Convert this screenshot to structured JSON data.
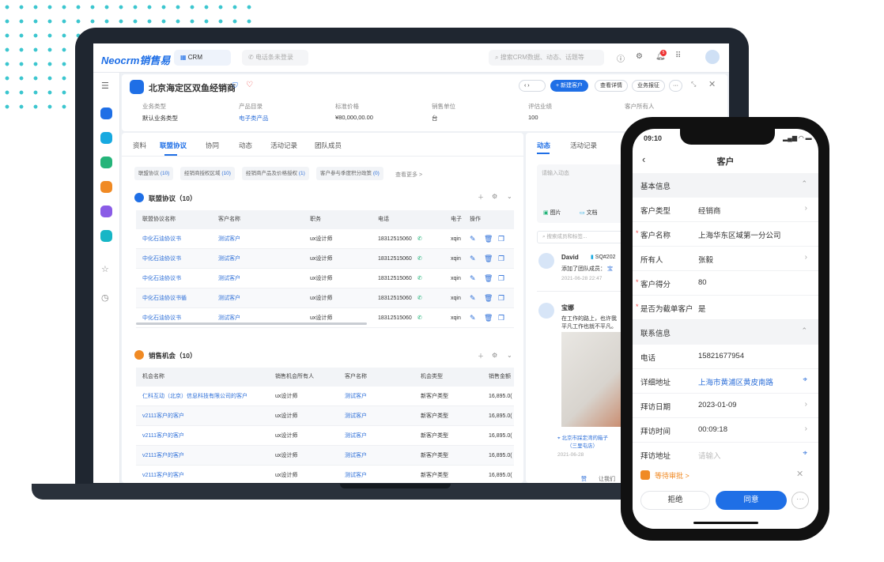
{
  "desktop": {
    "logo": "Neocrm销售易",
    "app_switch": "CRM",
    "phone_status": "电话条未登录",
    "search_placeholder": "搜索CRM数据、动态、话题等",
    "notification_count": "5",
    "record": {
      "title": "北京海定区双鱼经销商",
      "buttons": {
        "new": "+ 新建客户",
        "details": "查看详情",
        "report": "业务报征",
        "more": "···"
      },
      "fields": [
        {
          "label": "业务类型",
          "value": "默认业务类型"
        },
        {
          "label": "产品目录",
          "value": "电子类产品"
        },
        {
          "label": "标准价格",
          "value": "¥80,000,00.00"
        },
        {
          "label": "销售单位",
          "value": "台"
        },
        {
          "label": "评估业绩",
          "value": "100"
        },
        {
          "label": "客户所有人",
          "value": ""
        }
      ]
    },
    "tabs": [
      "资料",
      "联盟协议",
      "协同",
      "动态",
      "活动记录",
      "团队成员"
    ],
    "active_tab": "联盟协议",
    "chips": [
      {
        "label": "联盟协议",
        "count": "(10)"
      },
      {
        "label": "经销商授权区域",
        "count": "(10)"
      },
      {
        "label": "经销商产品及价格授权",
        "count": "(1)"
      },
      {
        "label": "客户参与季度积分政策",
        "count": "(0)"
      }
    ],
    "see_more": "查看更多 >",
    "agreements": {
      "title": "联盟协议（10）",
      "columns": [
        "联盟协议名称",
        "客户名称",
        "职务",
        "电话",
        "电子",
        "操作"
      ],
      "rows": [
        [
          "中化石油协议书",
          "测试客户",
          "ux设计师",
          "18312515060",
          "xqin"
        ],
        [
          "中化石油协议书",
          "测试客户",
          "ux设计师",
          "18312515060",
          "xqin"
        ],
        [
          "中化石油协议书",
          "测试客户",
          "ux设计师",
          "18312515060",
          "xqin"
        ],
        [
          "中化石油协议书循",
          "测试客户",
          "ux设计师",
          "18312515060",
          "xqin"
        ],
        [
          "中化石油协议书",
          "测试客户",
          "ux设计师",
          "18312515060",
          "xqin"
        ]
      ]
    },
    "opportunities": {
      "title": "销售机会（10）",
      "columns": [
        "机会名称",
        "销售机会所有人",
        "客户名称",
        "机会类型",
        "销售金额"
      ],
      "rows": [
        [
          "仁科互动（北京）信息科技有限公司的客户",
          "ux设计师",
          "测试客户",
          "新客户类型",
          "16,895.0("
        ],
        [
          "v2111客户的客户",
          "ux设计师",
          "测试客户",
          "新客户类型",
          "16,895.0("
        ],
        [
          "v2111客户的客户",
          "ux设计师",
          "测试客户",
          "新客户类型",
          "16,895.0("
        ],
        [
          "v2111客户的客户",
          "ux设计师",
          "测试客户",
          "新客户类型",
          "16,895.0("
        ],
        [
          "v2111客户的客户",
          "ux设计师",
          "测试客户",
          "新客户类型",
          "16,895.0("
        ]
      ]
    },
    "feed": {
      "tabs": [
        "动态",
        "活动记录"
      ],
      "input_placeholder": "请输入动态",
      "image_btn": "图片",
      "doc_btn": "文档",
      "search_placeholder": "搜索成员和标签...",
      "posts": [
        {
          "author": "David",
          "tag": "SQ#202",
          "text": "添加了团队成员：",
          "mention": "宝",
          "time": "2021-06-28 22:47"
        },
        {
          "author": "宝娜",
          "text": "在工作的路上，也许我",
          "text2": "平凡工作也就不平凡。",
          "location": "北京市踩定湾的箱子",
          "location2": "（三里屯店）",
          "time": "2021-06-28",
          "like": "赞",
          "comment": "让我们"
        }
      ]
    }
  },
  "mobile": {
    "time": "09:10",
    "title": "客户",
    "sections": [
      {
        "title": "基本信息",
        "rows": [
          {
            "label": "客户类型",
            "value": "经销商",
            "required": false,
            "chevron": true
          },
          {
            "label": "客户名称",
            "value": "上海华东区域第一分公司",
            "required": true
          },
          {
            "label": "所有人",
            "value": "张毅",
            "chevron": true
          },
          {
            "label": "客户得分",
            "value": "80",
            "required": true
          },
          {
            "label": "是否为截单客户",
            "value": "是",
            "required": true
          }
        ]
      },
      {
        "title": "联系信息",
        "rows": [
          {
            "label": "电话",
            "value": "15821677954"
          },
          {
            "label": "详细地址",
            "value": "上海市黄浦区黄皮南路",
            "link": true,
            "location": true
          },
          {
            "label": "拜访日期",
            "value": "2023-01-09",
            "chevron": true
          },
          {
            "label": "拜访时间",
            "value": "00:09:18",
            "chevron": true
          },
          {
            "label": "拜访地址",
            "value": "请输入",
            "placeholder": true,
            "location": true
          }
        ]
      }
    ],
    "approval": "等待审批 >",
    "reject": "拒绝",
    "approve": "同意"
  },
  "colors": {
    "primary": "#1f6fe6",
    "accent_teal": "#3cc6cf",
    "approval_orange": "#f08a24"
  }
}
